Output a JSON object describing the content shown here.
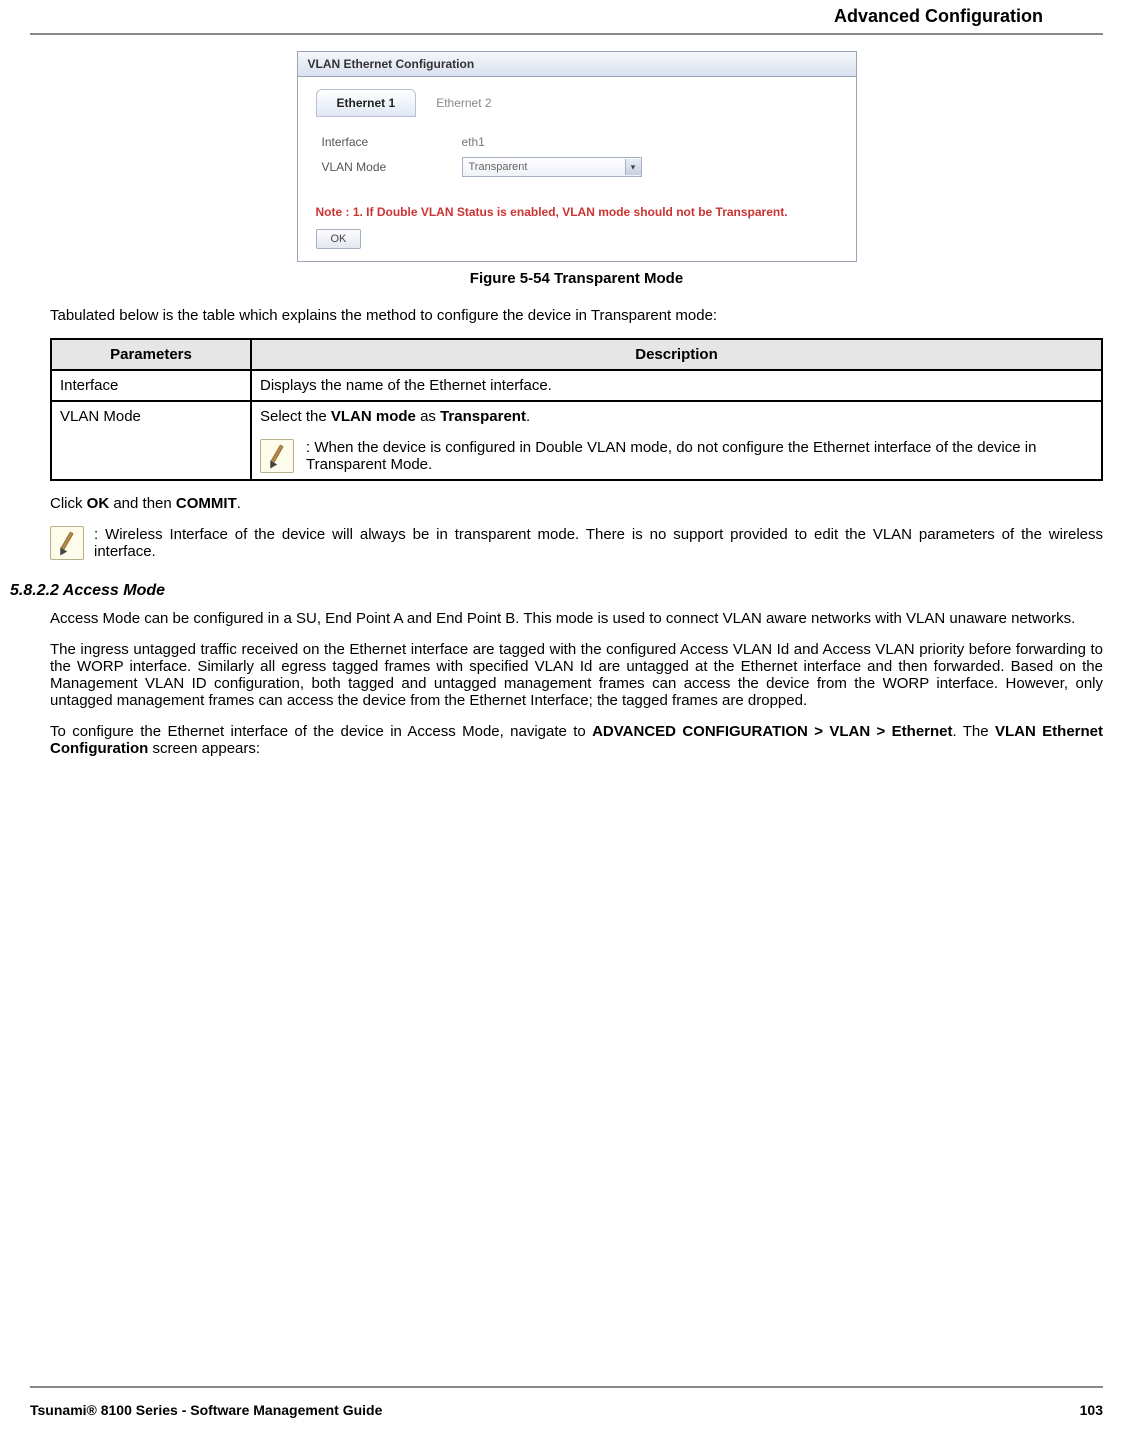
{
  "header": {
    "title": "Advanced Configuration"
  },
  "panel": {
    "title": "VLAN Ethernet Configuration",
    "tabs": {
      "active": "Ethernet 1",
      "inactive": "Ethernet 2"
    },
    "rows": {
      "interface": {
        "label": "Interface",
        "value": "eth1"
      },
      "vlanmode": {
        "label": "VLAN Mode",
        "value": "Transparent"
      }
    },
    "note": "Note :  1. If Double VLAN Status is enabled, VLAN mode should not be Transparent.",
    "ok": "OK"
  },
  "figure": {
    "caption": "Figure 5-54 Transparent Mode"
  },
  "intro": "Tabulated below is the table which explains the method to configure the device in Transparent mode:",
  "table": {
    "headers": {
      "param": "Parameters",
      "desc": "Description"
    },
    "rows": {
      "interface": {
        "param": "Interface",
        "desc": "Displays the name of the Ethernet interface."
      },
      "vlanmode": {
        "param": "VLAN Mode",
        "desc_prefix": "Select the ",
        "desc_bold1": "VLAN mode",
        "desc_mid": " as ",
        "desc_bold2": "Transparent",
        "desc_suffix": ".",
        "note": ": When the device is configured in Double VLAN mode, do not configure the Ethernet interface of the device in Transparent Mode."
      }
    }
  },
  "after_table": {
    "click_prefix": "Click ",
    "ok": "OK",
    "mid": " and then ",
    "commit": "COMMIT",
    "suffix": "."
  },
  "wireless_note": ": Wireless Interface of the device will always be in transparent mode. There is no support provided to edit the VLAN parameters of the wireless interface.",
  "section": {
    "number_title": "5.8.2.2 Access Mode",
    "p1": "Access Mode can be configured in a SU, End Point A and End Point B. This mode is used to connect VLAN aware networks with VLAN unaware networks.",
    "p2": "The ingress untagged traffic received on the Ethernet interface are tagged with the configured Access VLAN Id and Access VLAN priority before forwarding to the WORP interface. Similarly all egress tagged frames with specified VLAN Id are untagged at the Ethernet interface and then forwarded. Based on the Management VLAN ID configuration, both tagged and untagged management frames can access the device from the WORP interface. However, only untagged management frames can access the device from the Ethernet Interface; the tagged frames are dropped.",
    "p3_prefix": "To configure the Ethernet interface of the device in Access Mode, navigate to ",
    "p3_bold": "ADVANCED CONFIGURATION > VLAN > Ethernet",
    "p3_mid": ". The ",
    "p3_bold2": "VLAN Ethernet Configuration",
    "p3_suffix": " screen appears:"
  },
  "footer": {
    "left": "Tsunami® 8100 Series - Software Management Guide",
    "right": "103"
  }
}
